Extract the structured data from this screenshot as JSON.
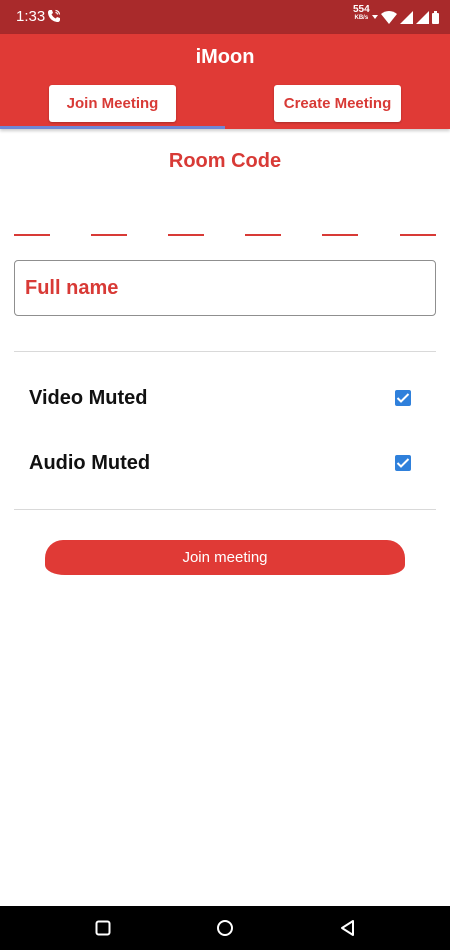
{
  "status_bar": {
    "time": "1:33",
    "net_speed": "554",
    "net_unit": "KB/s",
    "icons": [
      "phone-call-icon",
      "wifi-icon",
      "signal-icon",
      "signal-icon",
      "battery-icon"
    ]
  },
  "app": {
    "title": "iMoon",
    "tabs": [
      {
        "label": "Join Meeting",
        "active": true
      },
      {
        "label": "Create Meeting",
        "active": false
      }
    ]
  },
  "join_form": {
    "room_code_label": "Room Code",
    "room_code_slots": [
      "",
      "",
      "",
      "",
      "",
      ""
    ],
    "full_name": {
      "value": "",
      "placeholder": "Full name"
    },
    "options": [
      {
        "label": "Video Muted",
        "checked": true
      },
      {
        "label": "Audio Muted",
        "checked": true
      }
    ],
    "join_button_label": "Join meeting"
  },
  "nav_bar": {
    "buttons": [
      "recents-icon",
      "home-icon",
      "back-icon"
    ]
  },
  "colors": {
    "status_bar": "#a92a2b",
    "primary": "#e03a36",
    "accent_text": "#d83a36",
    "tab_indicator": "#6f87d6",
    "checkbox": "#2f80db"
  }
}
